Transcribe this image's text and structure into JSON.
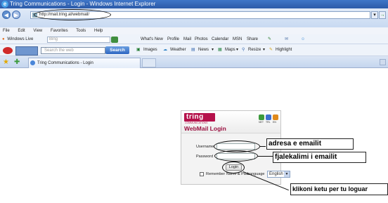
{
  "window": {
    "title": "Tring Communications - Login - Windows Internet Explorer"
  },
  "addressbar": {
    "url": "http://mail.tring.al/webmail/"
  },
  "menubar": {
    "items": [
      "File",
      "Edit",
      "View",
      "Favorites",
      "Tools",
      "Help"
    ]
  },
  "live_toolbar": {
    "brand": "Windows Live",
    "search_placeholder": "Bing",
    "links": [
      "What's New",
      "Profile",
      "Mail",
      "Photos",
      "Calendar",
      "MSN",
      "Share"
    ]
  },
  "msn_toolbar": {
    "search_placeholder": "Search the web",
    "search_button": "Search",
    "items": [
      "Images",
      "Weather",
      "News",
      "Maps",
      "Resize",
      "Highlight"
    ]
  },
  "tabs": [
    {
      "label": "Tring Communications - Login"
    }
  ],
  "login": {
    "logo_text": "tring",
    "logo_tagline": "COMMUNICATIONS",
    "title": "WebMail Login",
    "flags": [
      "NET",
      "TRL",
      "EN"
    ],
    "username_label": "Username",
    "password_label": "Password",
    "login_button": "Login",
    "remember_label": "Remember Name & Pass",
    "language_label": "Language",
    "language_value": "English"
  },
  "annotations": {
    "username": "adresa e emailit",
    "password": "fjalekalimi i emailit",
    "login": "klikoni ketu per  tu loguar"
  },
  "colors": {
    "brand": "#b5124b",
    "ie_blue": "#2b5aa8",
    "search_button": "#2f68c2"
  }
}
